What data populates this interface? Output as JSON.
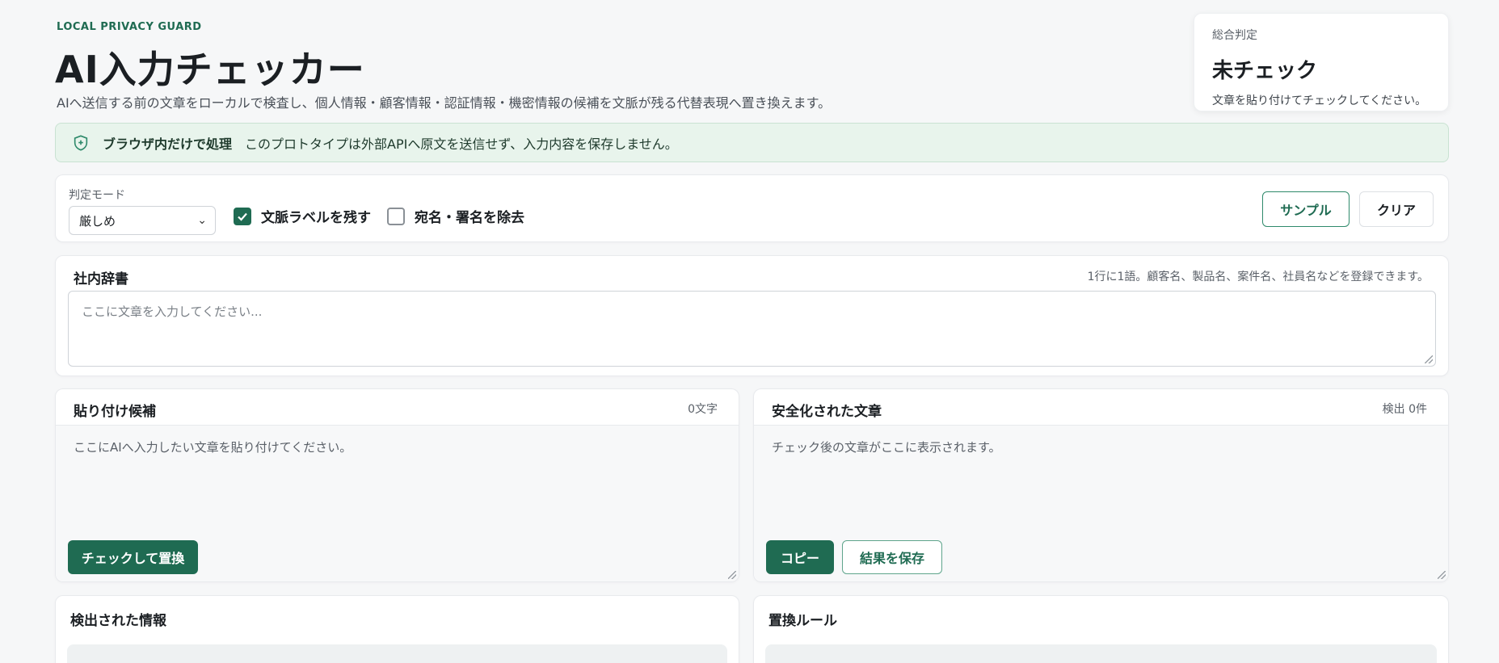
{
  "header": {
    "eyebrow": "LOCAL PRIVACY GUARD",
    "title": "AI入力チェッカー",
    "subtitle": "AIへ送信する前の文章をローカルで検査し、個人情報・顧客情報・認証情報・機密情報の候補を文脈が残る代替表現へ置き換えます。"
  },
  "verdict": {
    "label": "総合判定",
    "value": "未チェック",
    "hint": "文章を貼り付けてチェックしてください。"
  },
  "notice": {
    "strong": "ブラウザ内だけで処理",
    "text": "このプロトタイプは外部APIへ原文を送信せず、入力内容を保存しません。"
  },
  "toolbar": {
    "mode_label": "判定モード",
    "mode_value": "厳しめ",
    "keep_context_label": "文脈ラベルを残す",
    "keep_context_checked": true,
    "remove_signature_label": "宛名・署名を除去",
    "remove_signature_checked": false,
    "sample_label": "サンプル",
    "clear_label": "クリア"
  },
  "dictionary": {
    "title": "社内辞書",
    "hint": "1行に1語。顧客名、製品名、案件名、社員名などを登録できます。",
    "placeholder": "ここに文章を入力してください..."
  },
  "paste": {
    "title": "貼り付け候補",
    "count": "0文字",
    "placeholder": "ここにAIへ入力したい文章を貼り付けてください。",
    "check_button": "チェックして置換"
  },
  "safe": {
    "title": "安全化された文章",
    "count": "検出 0件",
    "placeholder": "チェック後の文章がここに表示されます。",
    "copy_button": "コピー",
    "save_button": "結果を保存"
  },
  "detected": {
    "title": "検出された情報"
  },
  "rules": {
    "title": "置換ルール"
  },
  "colors": {
    "accent": "#1f6b52",
    "notice_bg": "#e8f4ec"
  }
}
